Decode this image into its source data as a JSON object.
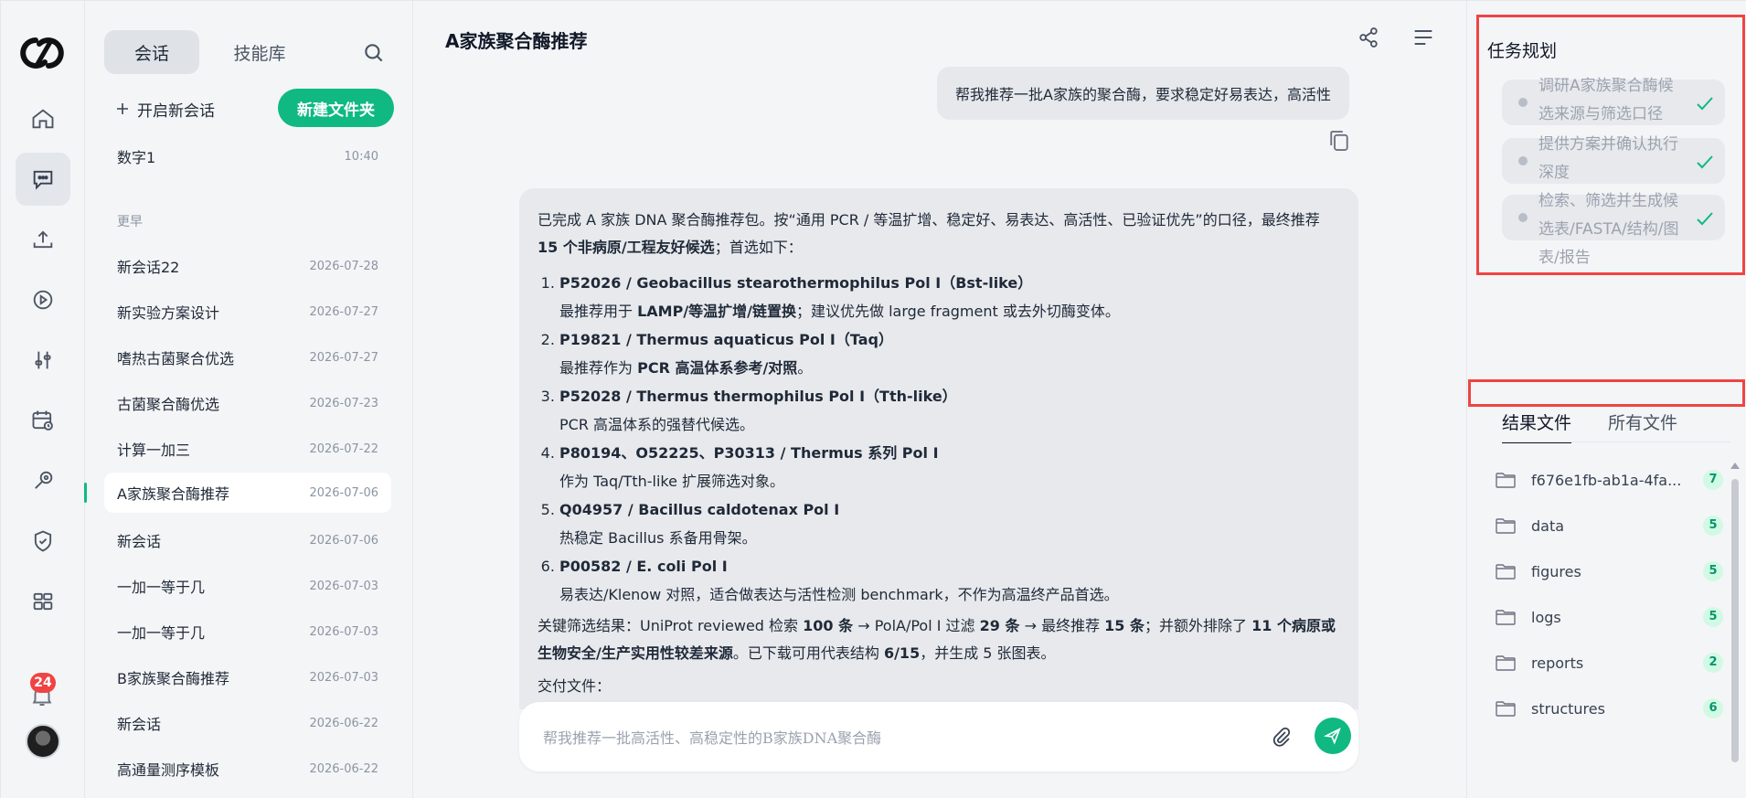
{
  "rail": {
    "badge_count": "24",
    "icons": [
      "home-icon",
      "chat-icon",
      "upload-icon",
      "play-circle-icon",
      "sliders-icon",
      "calendar-clock-icon",
      "stethoscope-icon",
      "shield-check-icon",
      "grid-icon"
    ]
  },
  "sidebar": {
    "tab_chat": "会话",
    "tab_skills": "技能库",
    "new_chat": "开启新会话",
    "new_folder": "新建文件夹",
    "section_earlier": "更早",
    "pinned": {
      "title": "数字1",
      "time": "10:40"
    },
    "conversations": [
      {
        "title": "新会话22",
        "date": "2026-07-28"
      },
      {
        "title": "新实验方案设计",
        "date": "2026-07-27"
      },
      {
        "title": "嗜热古菌聚合优选",
        "date": "2026-07-27"
      },
      {
        "title": "古菌聚合酶优选",
        "date": "2026-07-23"
      },
      {
        "title": "计算一加三",
        "date": "2026-07-22"
      },
      {
        "title": "A家族聚合酶推荐",
        "date": "2026-07-06"
      },
      {
        "title": "新会话",
        "date": "2026-07-06"
      },
      {
        "title": "一加一等于几",
        "date": "2026-07-03"
      },
      {
        "title": "一加一等于几",
        "date": "2026-07-03"
      },
      {
        "title": "B家族聚合酶推荐",
        "date": "2026-07-03"
      },
      {
        "title": "新会话",
        "date": "2026-06-22"
      },
      {
        "title": "高通量测序模板",
        "date": "2026-06-22"
      }
    ]
  },
  "main": {
    "title": "A家族聚合酶推荐",
    "user_message": "帮我推荐一批A家族的聚合酶，要求稳定好易表达，高活性",
    "answer": {
      "intro_1": "已完成 A 家族 DNA 聚合酶推荐包。按“通用 PCR / 等温扩增、稳定好、易表达、高活性、已验证优先”的口径，最终推荐 ",
      "intro_bold": "15 个非病原/工程友好候选",
      "intro_2": "；首选如下：",
      "items": [
        {
          "head": "P52026 / Geobacillus stearothermophilus Pol I（Bst-like）",
          "sub_pre": "最推荐用于 ",
          "sub_bold": "LAMP/等温扩增/链置换",
          "sub_post": "；建议优先做 large fragment 或去外切酶变体。"
        },
        {
          "head": "P19821 / Thermus aquaticus Pol I（Taq）",
          "sub_pre": "最推荐作为 ",
          "sub_bold": "PCR 高温体系参考/对照",
          "sub_post": "。"
        },
        {
          "head": "P52028 / Thermus thermophilus Pol I（Tth-like）",
          "sub_pre": "PCR 高温体系的强替代候选。",
          "sub_bold": "",
          "sub_post": ""
        },
        {
          "head": "P80194、O52225、P30313 / Thermus 系列 Pol I",
          "sub_pre": "作为 Taq/Tth-like 扩展筛选对象。",
          "sub_bold": "",
          "sub_post": ""
        },
        {
          "head": "Q04957 / Bacillus caldotenax Pol I",
          "sub_pre": "热稳定 Bacillus 系备用骨架。",
          "sub_bold": "",
          "sub_post": ""
        },
        {
          "head": "P00582 / E. coli Pol I",
          "sub_pre": "易表达/Klenow 对照，适合做表达与活性检测 benchmark，不作为高温终产品首选。",
          "sub_bold": "",
          "sub_post": ""
        }
      ],
      "filter_1": "关键筛选结果：UniProt reviewed 检索 ",
      "filter_b1": "100 条",
      "filter_2": " → PolA/Pol I 过滤 ",
      "filter_b2": "29 条",
      "filter_3": " → 最终推荐 ",
      "filter_b3": "15 条",
      "filter_4": "；并额外排除了 ",
      "filter_b4": "11 个病原或生物安全/生产实用性较差来源",
      "filter_5": "。已下载可用代表结构 ",
      "filter_b5": "6/15",
      "filter_6": "，并生成 5 张图表。",
      "deliver": "交付文件："
    },
    "input_placeholder": "帮我推荐一批高活性、高稳定性的B家族DNA聚合酶"
  },
  "right": {
    "plan_title": "任务规划",
    "tasks": [
      {
        "text": "调研A家族聚合酶候选来源与筛选口径",
        "status": "done"
      },
      {
        "text": "提供方案并确认执行深度",
        "status": "done"
      },
      {
        "text": "检索、筛选并生成候选表/FASTA/结构/图表/报告",
        "status": "done"
      }
    ],
    "tab_results": "结果文件",
    "tab_all": "所有文件",
    "files": [
      {
        "name": "f676e1fb-ab1a-4fa...",
        "count": "7"
      },
      {
        "name": "data",
        "count": "5"
      },
      {
        "name": "figures",
        "count": "5"
      },
      {
        "name": "logs",
        "count": "5"
      },
      {
        "name": "reports",
        "count": "2"
      },
      {
        "name": "structures",
        "count": "6"
      }
    ]
  },
  "colors": {
    "accent": "#10b981",
    "badge": "#ef4444",
    "highlight_box": "#ef4444"
  }
}
